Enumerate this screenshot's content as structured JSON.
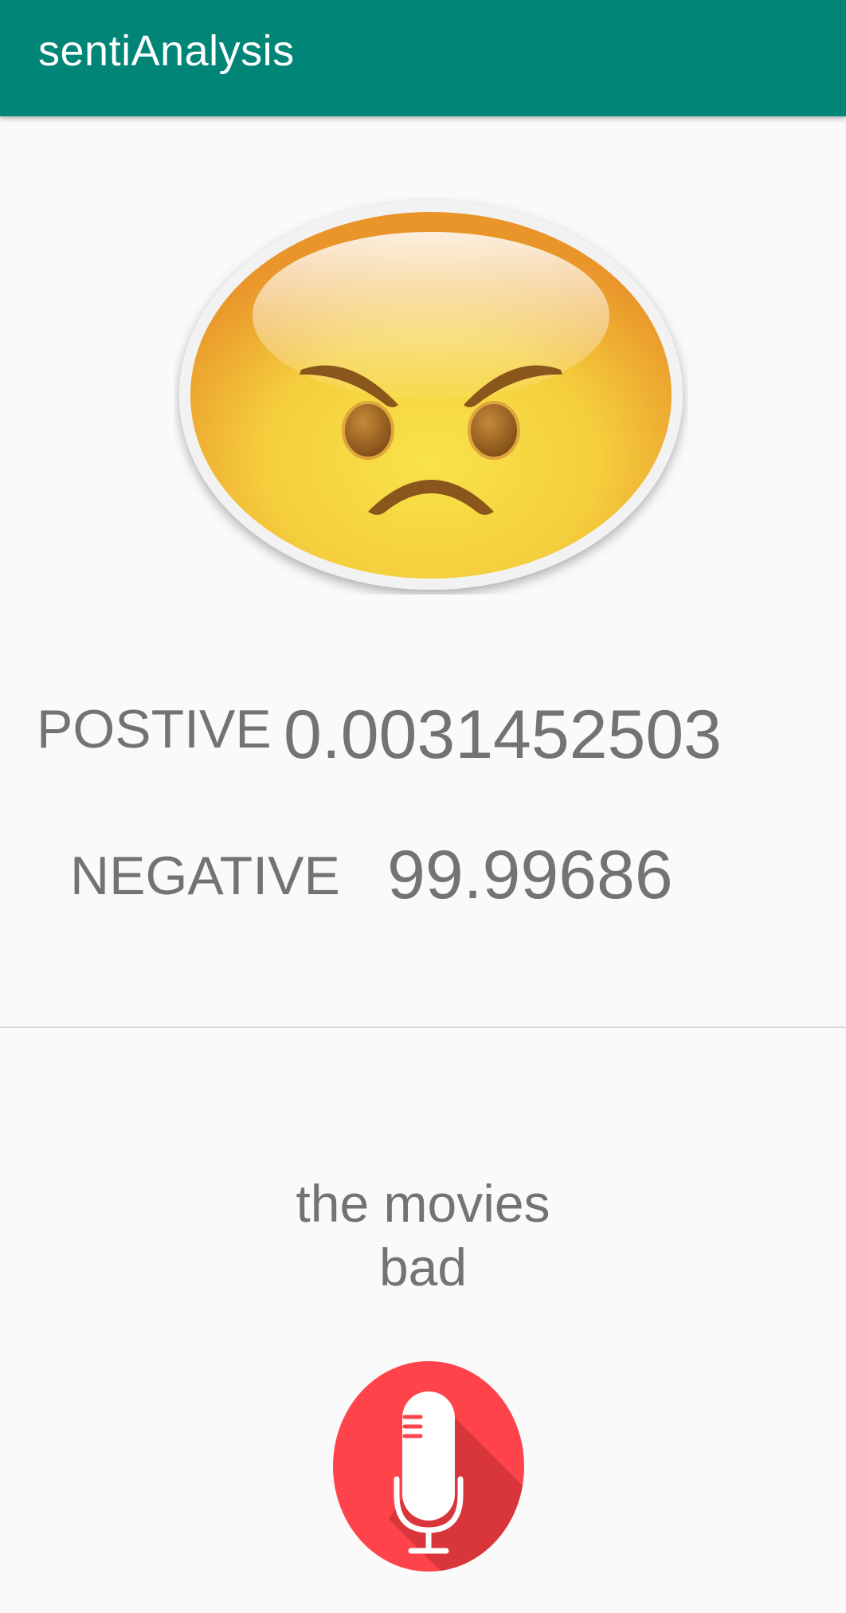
{
  "app_bar": {
    "title": "sentiAnalysis",
    "color": "#008577"
  },
  "result": {
    "emoji": "angry-face-icon",
    "positive_label": "POSTIVE",
    "positive_value": "0.0031452503",
    "negative_label": "NEGATIVE",
    "negative_value": "99.99686"
  },
  "speech": {
    "text": "the movies\nbad"
  },
  "mic": {
    "icon": "microphone-icon",
    "color": "#fe444a"
  }
}
